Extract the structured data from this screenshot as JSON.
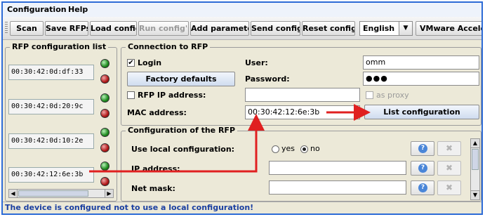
{
  "menu": {
    "configuration": "Configuration",
    "help": "Help"
  },
  "toolbar": {
    "scan": "Scan",
    "save_rfps": "Save RFPs",
    "load_config": "Load config",
    "run_configs": "Run config's",
    "add_parameter": "Add parameter",
    "send_config": "Send config.",
    "reset_config": "Reset config.",
    "language": "English",
    "vmware": "VMware Accelerate"
  },
  "rfp_list": {
    "title": "RFP configuration list",
    "items": [
      {
        "mac": "00:30:42:0d:df:33"
      },
      {
        "mac": "00:30:42:0d:20:9c"
      },
      {
        "mac": "00:30:42:0d:10:2e"
      },
      {
        "mac": "00:30:42:12:6e:3b"
      }
    ]
  },
  "connection": {
    "title": "Connection to RFP",
    "login_label": "Login",
    "login_checked": true,
    "user_label": "User:",
    "user_value": "omm",
    "factory_defaults": "Factory defaults",
    "password_label": "Password:",
    "password_value": "●●●",
    "rfp_ip_label": "RFP IP address:",
    "rfp_ip_value": "",
    "as_proxy_label": "as proxy",
    "mac_label": "MAC address:",
    "mac_value": "00:30:42:12:6e:3b",
    "list_configuration": "List configuration"
  },
  "rfp_config": {
    "title": "Configuration of the RFP",
    "rows": [
      {
        "label": "Use local configuration:",
        "yes": "yes",
        "no": "no",
        "selected": "no"
      },
      {
        "label": "IP address:",
        "value": ""
      },
      {
        "label": "Net mask:",
        "value": ""
      }
    ]
  },
  "status": "The device is configured not to use a local configuration!",
  "colors": {
    "frame": "#2d6bd6",
    "annotation_arrow": "#e02020",
    "status_text": "#1a3fa0"
  },
  "icons": {
    "help": "question-icon",
    "delete": "delete-x-icon",
    "led_on": "green-led-icon",
    "led_off": "red-led-icon"
  }
}
